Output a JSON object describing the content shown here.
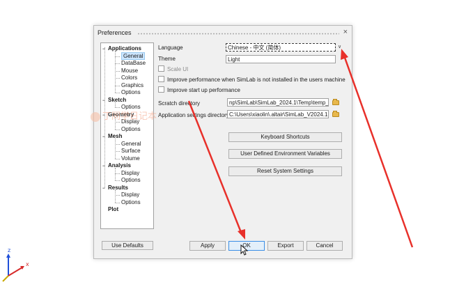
{
  "dialog": {
    "title": "Preferences",
    "close_glyph": "×"
  },
  "tree": [
    {
      "label": "Applications",
      "level": 0,
      "expander": "−"
    },
    {
      "label": "General",
      "level": 1,
      "selected": true
    },
    {
      "label": "DataBase",
      "level": 1
    },
    {
      "label": "Mouse",
      "level": 1
    },
    {
      "label": "Colors",
      "level": 1
    },
    {
      "label": "Graphics",
      "level": 1
    },
    {
      "label": "Options",
      "level": 1
    },
    {
      "label": "Sketch",
      "level": 0,
      "expander": "−"
    },
    {
      "label": "Options",
      "level": 1
    },
    {
      "label": "Geometry",
      "level": 0,
      "expander": "−"
    },
    {
      "label": "Display",
      "level": 1
    },
    {
      "label": "Options",
      "level": 1
    },
    {
      "label": "Mesh",
      "level": 0,
      "expander": "−"
    },
    {
      "label": "General",
      "level": 1
    },
    {
      "label": "Surface",
      "level": 1
    },
    {
      "label": "Volume",
      "level": 1
    },
    {
      "label": "Analysis",
      "level": 0,
      "expander": "−"
    },
    {
      "label": "Display",
      "level": 1
    },
    {
      "label": "Options",
      "level": 1
    },
    {
      "label": "Results",
      "level": 0,
      "expander": "−"
    },
    {
      "label": "Display",
      "level": 1
    },
    {
      "label": "Options",
      "level": 1
    },
    {
      "label": "Plot",
      "level": 0,
      "expander": ""
    }
  ],
  "general": {
    "language_label": "Language",
    "language_value": "Chinese - 中文 (简体)",
    "theme_label": "Theme",
    "theme_value": "Light",
    "scale_ui_label": "Scale UI",
    "improve_perf_simlab_label": "Improve performance when SimLab is not installed in the users machine",
    "improve_startup_label": "Improve start up performance",
    "scratch_dir_label": "Scratch directory",
    "scratch_dir_value": "np\\SimLab\\SimLab_2024.1\\Temp\\temp_1",
    "app_settings_dir_label": "Application settings directory",
    "app_settings_dir_value": "C:\\Users\\xiaolin\\.altair\\SimLab_V2024.1"
  },
  "buttons": {
    "keyboard_shortcuts": "Keyboard Shortcuts",
    "user_env_vars": "User Defined Environment Variables",
    "reset_settings": "Reset System Settings",
    "use_defaults": "Use Defaults",
    "apply": "Apply",
    "ok": "OK",
    "export": "Export",
    "cancel": "Cancel"
  },
  "watermark": {
    "text": "丁同学日记本"
  },
  "axes": {
    "z_label": "z",
    "x_label": "x"
  },
  "colors": {
    "annotation_arrow": "#e8302a",
    "axis_z": "#1f4fd8",
    "axis_x": "#d62a2a",
    "axis_y": "#c9a900",
    "default_button_border": "#3a8ee6"
  }
}
